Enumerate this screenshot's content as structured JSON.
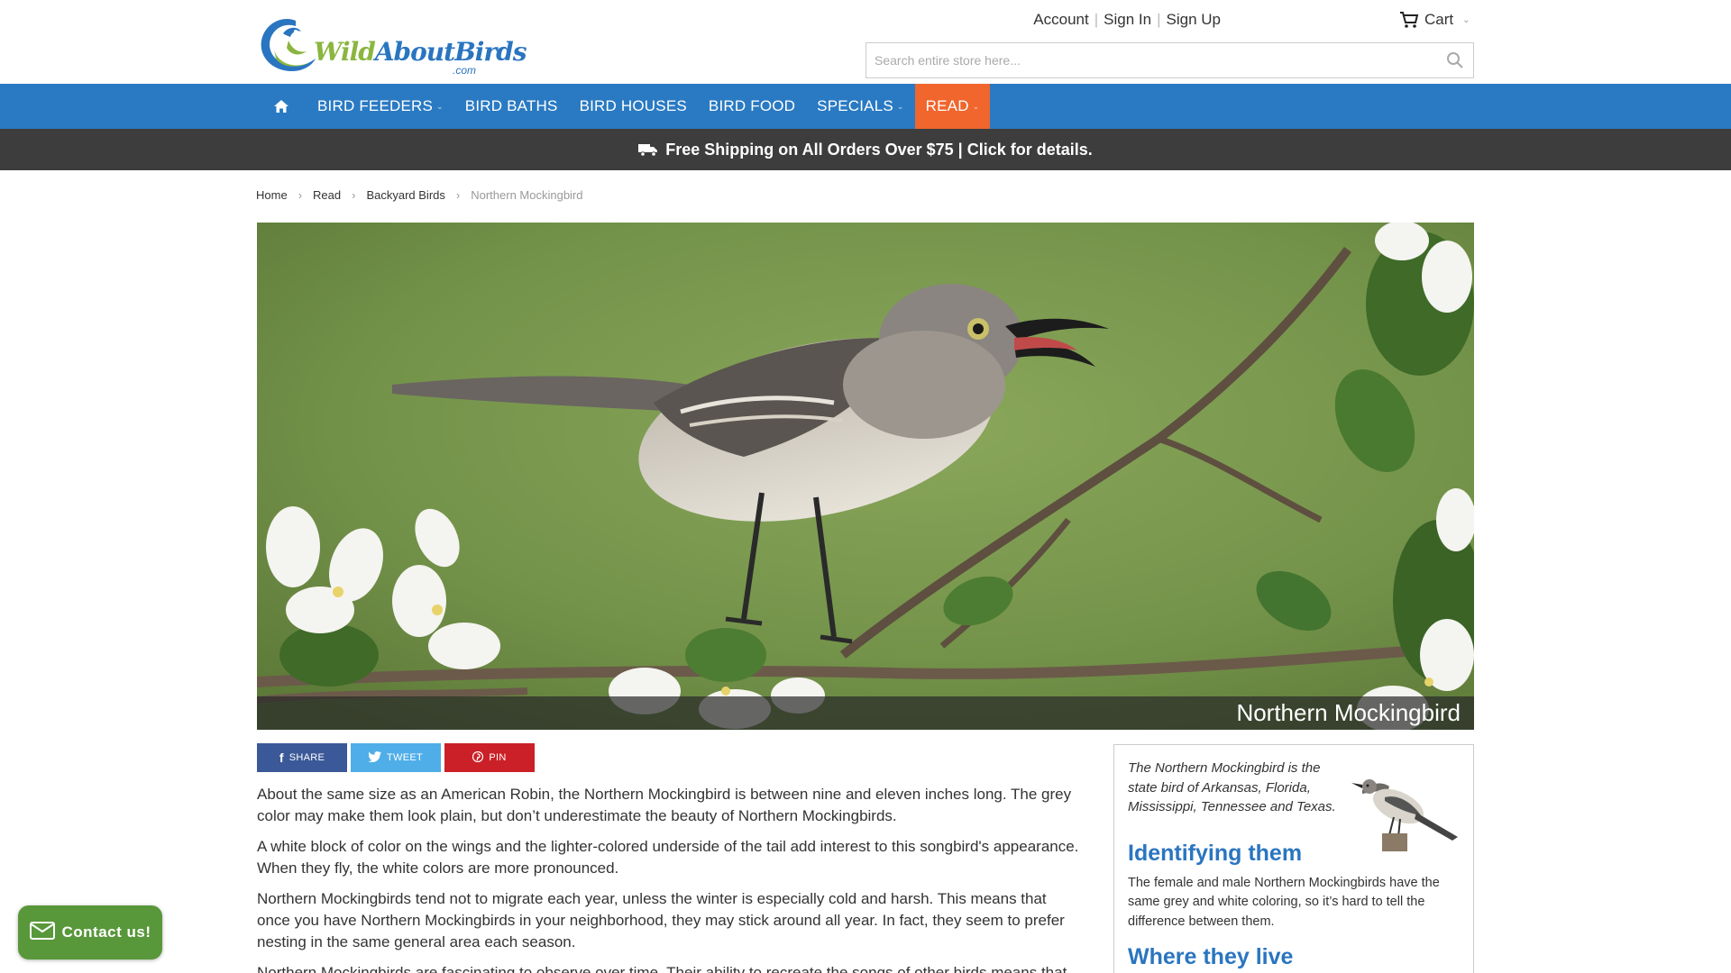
{
  "brand": {
    "word1": "Wild",
    "word2": "About",
    "word3": "Birds",
    "suffix": ".com"
  },
  "toplinks": {
    "account": "Account",
    "sign_in": "Sign In",
    "sign_up": "Sign Up",
    "cart": "Cart"
  },
  "search": {
    "placeholder": "Search entire store here..."
  },
  "nav": {
    "items": [
      {
        "label": "BIRD FEEDERS"
      },
      {
        "label": "BIRD BATHS"
      },
      {
        "label": "BIRD HOUSES"
      },
      {
        "label": "BIRD FOOD"
      },
      {
        "label": "SPECIALS"
      },
      {
        "label": "READ"
      }
    ]
  },
  "shipping": {
    "text": "Free Shipping on All Orders Over $75 | Click for details."
  },
  "breadcrumb": {
    "home": "Home",
    "read": "Read",
    "section": "Backyard Birds",
    "current": "Northern Mockingbird"
  },
  "hero": {
    "caption": "Northern Mockingbird"
  },
  "share": {
    "facebook": "SHARE",
    "twitter": "TWEET",
    "pinterest": "PIN"
  },
  "article": {
    "paragraphs": [
      "About the same size as an American Robin, the Northern Mockingbird is between nine and eleven inches long. The grey color may make them look plain, but don’t underestimate the beauty of Northern Mockingbirds.",
      "A white block of color on the wings and the lighter-colored underside of the tail add interest to this songbird's appearance. When they fly, the white colors are more pronounced.",
      "Northern Mockingbirds tend not to migrate each year, unless the winter is especially cold and harsh. This means that once you have Northern Mockingbirds in your neighborhood, they may stick around all year. In fact, they seem to prefer nesting in the same general area each season.",
      "Northern Mockingbirds are fascinating to observe over time. Their ability to recreate the songs of other birds means that"
    ]
  },
  "sidebar": {
    "intro": "The Northern Mockingbird is the state bird of Arkansas, Florida, Mississippi, Tennessee and Texas.",
    "heading1": "Identifying them",
    "text1": "The female and male Northern Mockingbirds have the same grey and white coloring, so it’s hard to tell the difference between them.",
    "heading2": "Where they live"
  },
  "contact": {
    "label": "Contact us!"
  },
  "colors": {
    "nav_blue": "#2a7ac3",
    "active_orange": "#f0662d",
    "ship_bar": "#3d3d3d",
    "heading_blue": "#2a75c0",
    "contact_green": "#58973a"
  }
}
